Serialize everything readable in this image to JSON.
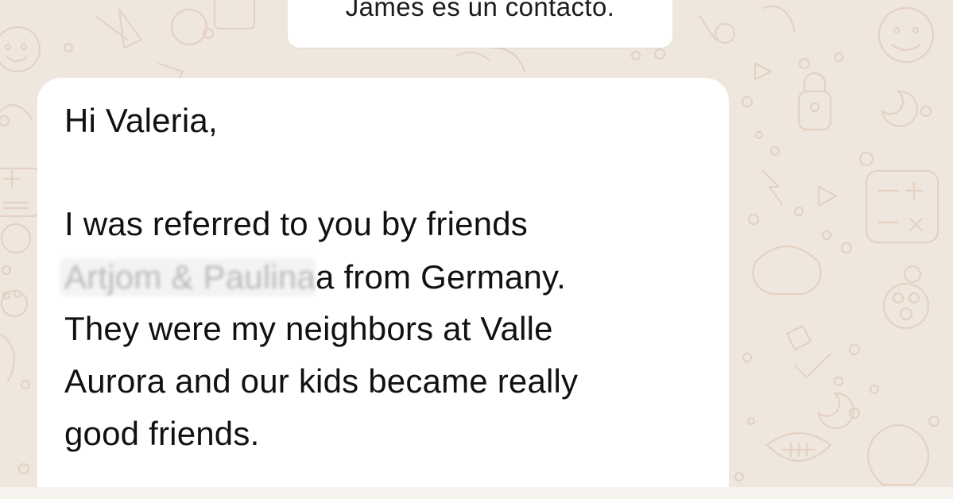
{
  "system_notice": {
    "text": "James es un contacto."
  },
  "message": {
    "greeting": "Hi Valeria,",
    "line1": "I was referred to you by friends",
    "line2_redacted": "Artjom & Paulina",
    "line2_rest": "a from Germany.",
    "line3": "They were my neighbors at Valle",
    "line4": "Aurora and our kids became really",
    "line5": "good friends."
  },
  "colors": {
    "wallpaper": "#efe7dd",
    "wallpaper_doodle": "#e2cdbd",
    "bubble": "#ffffff",
    "text": "#111111"
  }
}
